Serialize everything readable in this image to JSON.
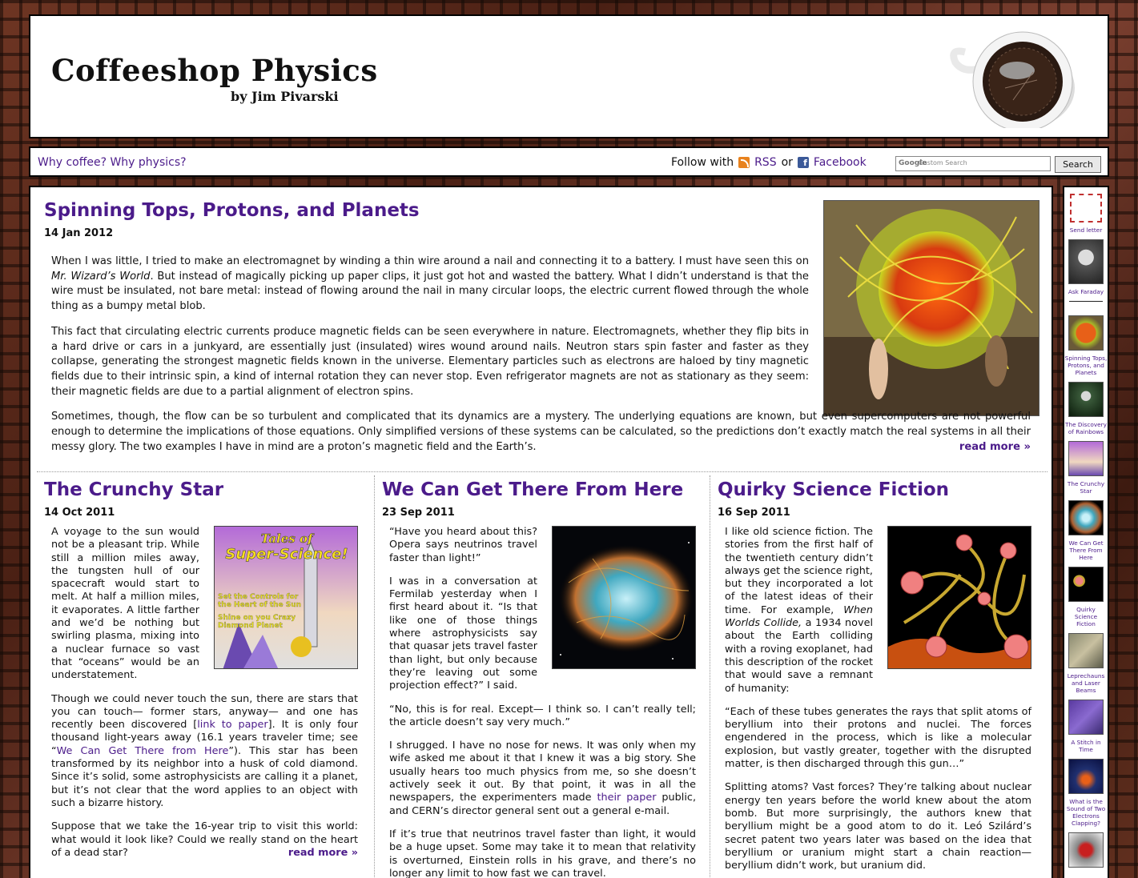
{
  "header": {
    "title": "Coffeeshop Physics",
    "byline": "by Jim Pivarski"
  },
  "nav": {
    "why": "Why coffee? Why physics?",
    "follow_prefix": "Follow with",
    "rss": "RSS",
    "or": "or",
    "facebook": "Facebook",
    "search_placeholder": "Custom Search",
    "search_button": "Search"
  },
  "feature": {
    "title": "Spinning Tops, Protons, and Planets",
    "date": "14 Jan 2012",
    "p1": "When I was little, I tried to make an electromagnet by winding a thin wire around a nail and connecting it to a battery. I must have seen this on ",
    "p1_em": "Mr. Wizard’s World",
    "p1_rest": ". But instead of magically picking up paper clips, it just got hot and wasted the battery. What I didn’t understand is that the wire must be insulated, not bare metal: instead of flowing around the nail in many circular loops, the electric current flowed through the whole thing as a bumpy metal blob.",
    "p2": "This fact that circulating electric currents produce magnetic fields can be seen everywhere in nature. Electromagnets, whether they flip bits in a hard drive or cars in a junkyard, are essentially just (insulated) wires wound around nails. Neutron stars spin faster and faster as they collapse, generating the strongest magnetic fields known in the universe. Elementary particles such as electrons are haloed by tiny magnetic fields due to their intrinsic spin, a kind of internal rotation they can never stop. Even refrigerator magnets are not as stationary as they seem: their magnetic fields are due to a partial alignment of electron spins.",
    "p3": "Sometimes, though, the flow can be so turbulent and complicated that its dynamics are a mystery. The underlying equations are known, but even supercomputers are not powerful enough to determine the implications of those equations. Only simplified versions of these systems can be calculated, so the predictions don’t exactly match the real systems in all their messy glory. The two examples I have in mind are a proton’s magnetic field and the Earth’s.",
    "readmore": "read more »"
  },
  "posts": [
    {
      "title": "The Crunchy Star",
      "date": "14 Oct 2011",
      "thumb": {
        "line1": "Tales of",
        "line2": "Super-Science!",
        "sub1": "Set the Controls for",
        "sub2": "the Heart of the Sun",
        "sub3": "Shine on you Crazy",
        "sub4": "Diamond Planet"
      },
      "p1": "A voyage to the sun would not be a pleasant trip. While still a million miles away, the tungsten hull of our spacecraft would start to melt. At half a million miles, it evaporates. A little farther and we’d be nothing but swirling plasma, mixing into a nuclear furnace so vast that “oceans” would be an understatement.",
      "p2a": "Though we could never touch the sun, there are stars that you can touch— former stars, anyway— and one has recently been discovered [",
      "p2link": "link to paper",
      "p2b": "]. It is only four thousand light-years away (16.1 years traveler time; see “",
      "p2link2": "We Can Get There from Here",
      "p2c": "”). This star has been transformed by its neighbor into a husk of cold diamond. Since it’s solid, some astrophysicists are calling it a planet, but it’s not clear that the word applies to an object with such a bizarre history.",
      "p3": "Suppose that we take the 16-year trip to visit this world: what would it look like? Could we really stand on the heart of a dead star?",
      "readmore": "read more »"
    },
    {
      "title": "We Can Get There From Here",
      "date": "23 Sep 2011",
      "p1": "“Have you heard about this? Opera says neutrinos travel faster than light!”",
      "p2": "I was in a conversation at Fermilab yesterday when I first heard about it. “Is that like one of those things where astrophysicists say that quasar jets travel faster than light, but only because they’re leaving out some projection effect?” I said.",
      "p3": "“No, this is for real. Except— I think so. I can’t really tell; the article doesn’t say very much.”",
      "p4a": "I shrugged. I have no nose for news. It was only when my wife asked me about it that I knew it was a big story. She usually hears too much physics from me, so she doesn’t actively seek it out. By that point, it was in all the newspapers, the experimenters made ",
      "p4link": "their paper",
      "p4b": " public, and CERN’s director general sent out a general e-mail.",
      "p5": "If it’s true that neutrinos travel faster than light, it would be a huge upset. Some may take it to mean that relativity is overturned, Einstein rolls in his grave, and there’s no longer any limit to how fast we can travel."
    },
    {
      "title": "Quirky Science Fiction",
      "date": "16 Sep 2011",
      "p1a": "I like old science fiction. The stories from the first half of the twentieth century didn’t always get the science right, but they incorporated a lot of the latest ideas of their time. For example, ",
      "p1em": "When Worlds Collide,",
      "p1b": " a 1934 novel about the Earth colliding with a roving exoplanet, had this description of the rocket that would save a remnant of humanity:",
      "p2": "“Each of these tubes generates the rays that split atoms of beryllium into their protons and nuclei. The forces engendered in the process, which is like a molecular explosion, but vastly greater, together with the disrupted matter, is then discharged through this gun…”",
      "p3": "Splitting atoms? Vast forces? They’re talking about nuclear energy ten years before the world knew about the atom bomb. But more surprisingly, the authors knew that beryllium might be a good atom to do it. Leó Szilárd’s secret patent two years later was based on the idea that beryllium or uranium might start a chain reaction— beryllium didn’t work, but uranium did."
    }
  ],
  "sidebar": {
    "top": [
      {
        "label": "Send letter",
        "icon": "airmail-stamp-icon"
      },
      {
        "label": "Ask Faraday",
        "icon": "faraday-portrait-icon"
      }
    ],
    "links": [
      "Spinning Tops, Protons, and Planets",
      "The Discovery of Rainbows",
      "The Crunchy Star",
      "We Can Get There From Here",
      "Quirky Science Fiction",
      "Leprechauns and Laser Beams",
      "A Stitch in Time",
      "What is the Sound of Two Electrons Clapping?",
      ""
    ]
  },
  "colors": {
    "link": "#4b1b8a",
    "brick": "#5a2a1c"
  }
}
